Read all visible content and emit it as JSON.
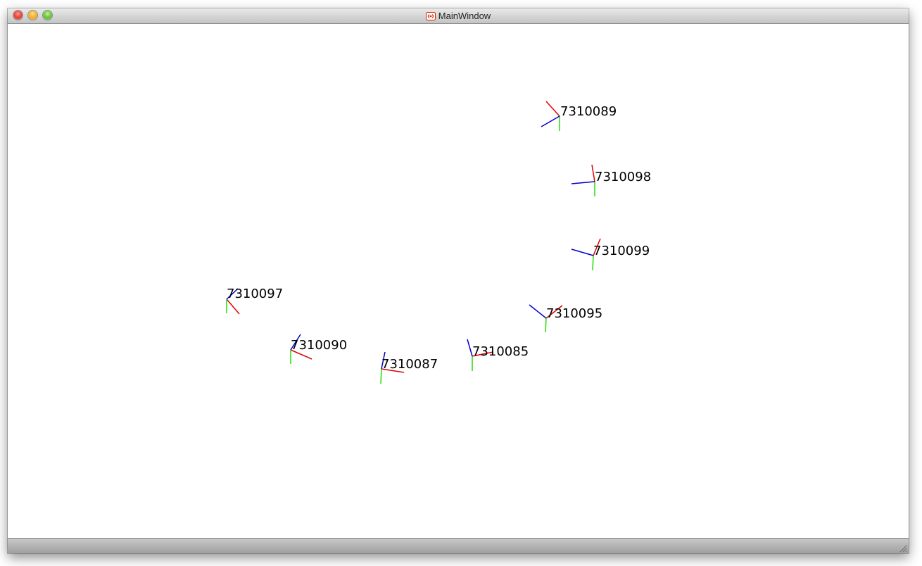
{
  "window": {
    "title": "MainWindow"
  },
  "markers": [
    {
      "id": "7310089"
    },
    {
      "id": "7310098"
    },
    {
      "id": "7310099"
    },
    {
      "id": "7310097"
    },
    {
      "id": "7310095"
    },
    {
      "id": "7310090"
    },
    {
      "id": "7310087"
    },
    {
      "id": "7310085"
    }
  ],
  "axis_colors": {
    "x": "#e00000",
    "y": "#22dd00",
    "z": "#0000cc"
  }
}
